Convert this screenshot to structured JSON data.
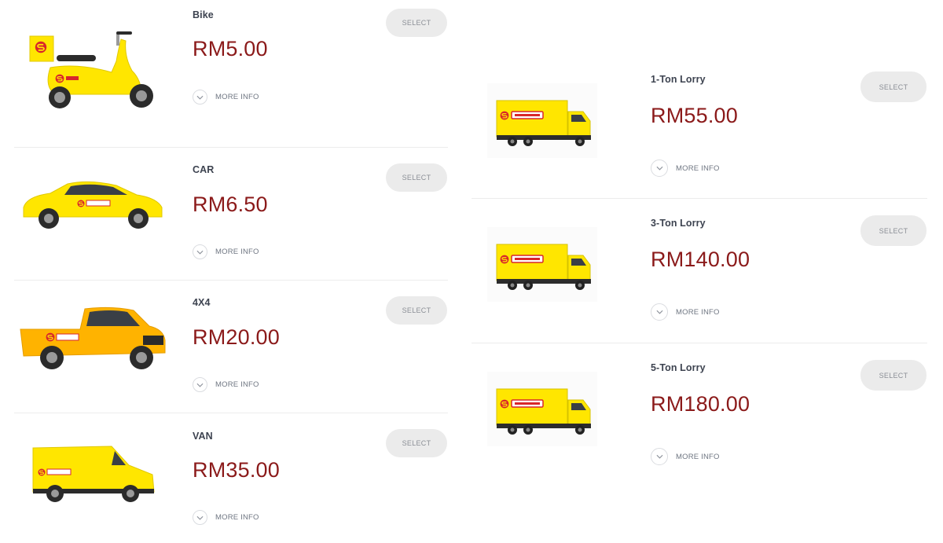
{
  "colors": {
    "price": "#8b1a1a",
    "vehicle_yellow": "#ffe600",
    "select_bg": "#ebebeb"
  },
  "vehicles": [
    {
      "name": "Bike",
      "price": "RM5.00",
      "more_info": "MORE INFO",
      "select": "SELECT",
      "icon": "scooter-icon"
    },
    {
      "name": "CAR",
      "price": "RM6.50",
      "more_info": "MORE INFO",
      "select": "SELECT",
      "icon": "car-icon"
    },
    {
      "name": "4X4",
      "price": "RM20.00",
      "more_info": "MORE INFO",
      "select": "SELECT",
      "icon": "pickup-truck-icon"
    },
    {
      "name": "VAN",
      "price": "RM35.00",
      "more_info": "MORE INFO",
      "select": "SELECT",
      "icon": "van-icon"
    },
    {
      "name": "1-Ton Lorry",
      "price": "RM55.00",
      "more_info": "MORE INFO",
      "select": "SELECT",
      "icon": "lorry-icon"
    },
    {
      "name": "3-Ton Lorry",
      "price": "RM140.00",
      "more_info": "MORE INFO",
      "select": "SELECT",
      "icon": "lorry-icon"
    },
    {
      "name": "5-Ton Lorry",
      "price": "RM180.00",
      "more_info": "MORE INFO",
      "select": "SELECT",
      "icon": "lorry-icon"
    }
  ]
}
